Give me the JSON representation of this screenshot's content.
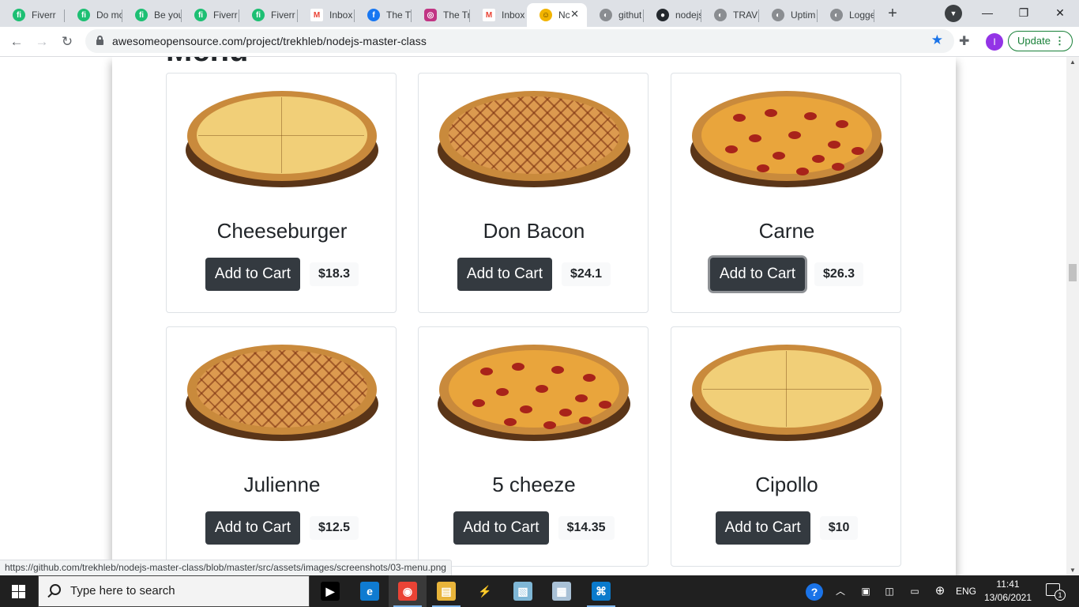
{
  "browser": {
    "tabs": [
      {
        "title": "Fiverr",
        "icon": "fiverr-icon",
        "color": "#1dbf73"
      },
      {
        "title": "Do mo",
        "icon": "fiverr-icon",
        "color": "#1dbf73"
      },
      {
        "title": "Be you",
        "icon": "fiverr-icon",
        "color": "#1dbf73"
      },
      {
        "title": "Fiverr",
        "icon": "fiverr-icon",
        "color": "#1dbf73"
      },
      {
        "title": "Fiverr",
        "icon": "fiverr-icon",
        "color": "#1dbf73"
      },
      {
        "title": "Inbox",
        "icon": "gmail-icon",
        "color": "#ea4335"
      },
      {
        "title": "The Tr",
        "icon": "facebook-icon",
        "color": "#1877f2"
      },
      {
        "title": "The Tr",
        "icon": "instagram-icon",
        "color": "#c13584"
      },
      {
        "title": "Inbox",
        "icon": "gmail-icon",
        "color": "#ea4335"
      },
      {
        "title": "Nc",
        "icon": "emoji-icon",
        "color": "#f2b400"
      },
      {
        "title": "githut",
        "icon": "globe-icon",
        "color": "#5f6368"
      },
      {
        "title": "nodejs",
        "icon": "github-icon",
        "color": "#24292e"
      },
      {
        "title": "TRAVE",
        "icon": "globe-icon",
        "color": "#5f6368"
      },
      {
        "title": "Uptim",
        "icon": "globe-icon",
        "color": "#5f6368"
      },
      {
        "title": "Logge",
        "icon": "globe-icon",
        "color": "#5f6368"
      }
    ],
    "url": "awesomeopensource.com/project/trekhleb/nodejs-master-class",
    "update_label": "Update",
    "profile_initial": "I",
    "status_url": "https://github.com/trekhleb/nodejs-master-class/blob/master/src/assets/images/screenshots/03-menu.png"
  },
  "page": {
    "heading": "Menu",
    "items": [
      {
        "name": "Cheeseburger",
        "price": "$18.3",
        "button": "Add to Cart",
        "style": "cheese"
      },
      {
        "name": "Don Bacon",
        "price": "$24.1",
        "button": "Add to Cart",
        "style": "bbq"
      },
      {
        "name": "Carne",
        "price": "$26.3",
        "button": "Add to Cart",
        "style": "pepperoni"
      },
      {
        "name": "Julienne",
        "price": "$12.5",
        "button": "Add to Cart",
        "style": "bbq"
      },
      {
        "name": "5 cheeze",
        "price": "$14.35",
        "button": "Add to Cart",
        "style": "pepperoni"
      },
      {
        "name": "Cipollo",
        "price": "$10",
        "button": "Add to Cart",
        "style": "cheese"
      }
    ]
  },
  "taskbar": {
    "search_placeholder": "Type here to search",
    "language": "ENG",
    "time": "11:41",
    "date": "13/06/2021",
    "notification_count": "1",
    "apps": [
      {
        "name": "terminal-app",
        "icon": "terminal-icon",
        "color": "#000000"
      },
      {
        "name": "edge-app",
        "icon": "edge-icon",
        "color": "#0f7bd1"
      },
      {
        "name": "chrome-app",
        "icon": "chrome-icon",
        "color": "#ea4335"
      },
      {
        "name": "explorer-app",
        "icon": "folder-icon",
        "color": "#e8b43a"
      },
      {
        "name": "app-5",
        "icon": "bolt-icon",
        "color": "#202020"
      },
      {
        "name": "app-6",
        "icon": "notes-icon",
        "color": "#7fb7d6"
      },
      {
        "name": "app-7",
        "icon": "window-icon",
        "color": "#a9c1d6"
      },
      {
        "name": "vscode-app",
        "icon": "vscode-icon",
        "color": "#0a7acc"
      }
    ]
  }
}
